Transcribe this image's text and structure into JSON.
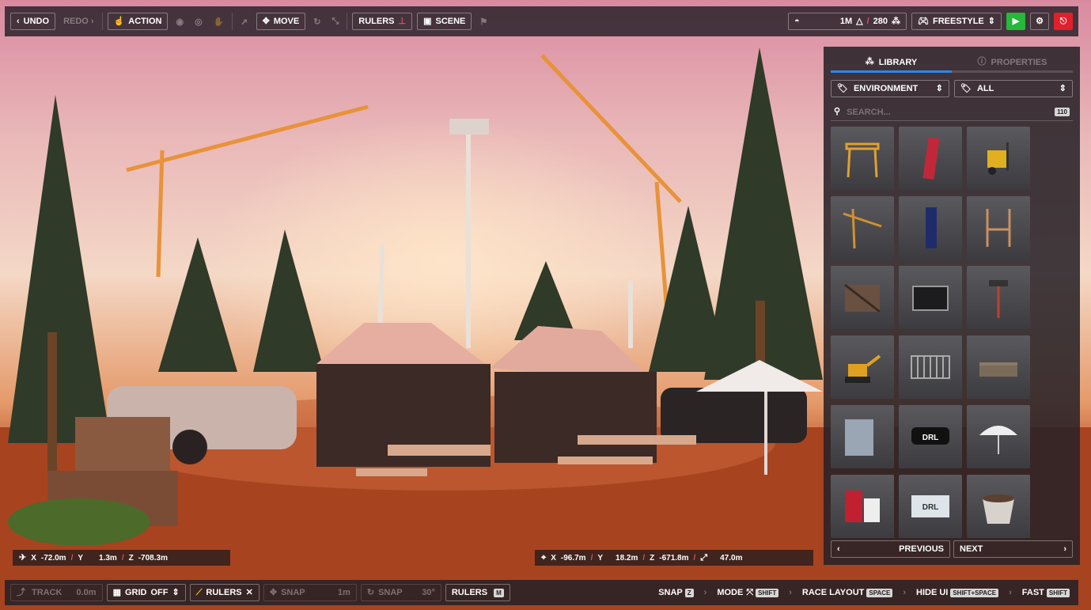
{
  "toolbar": {
    "undo": "UNDO",
    "redo": "REDO",
    "action": "ACTION",
    "move": "MOVE",
    "rulers": "RULERS",
    "scene": "SCENE",
    "polycount": "1M",
    "objectcount": "280",
    "mode": "FREESTYLE"
  },
  "panel": {
    "tab_library": "LIBRARY",
    "tab_properties": "PROPERTIES",
    "category": "ENVIRONMENT",
    "filter": "ALL",
    "search_placeholder": "SEARCH...",
    "item_count": "110",
    "previous": "PREVIOUS",
    "next": "NEXT",
    "items": [
      {
        "icon": "crane-gantry"
      },
      {
        "icon": "banner-flag-red"
      },
      {
        "icon": "forklift"
      },
      {
        "icon": "tower-crane"
      },
      {
        "icon": "banner-flag-blue"
      },
      {
        "icon": "goal-post"
      },
      {
        "icon": "wooden-crate"
      },
      {
        "icon": "flight-case"
      },
      {
        "icon": "light-tower"
      },
      {
        "icon": "excavator"
      },
      {
        "icon": "metal-barrier"
      },
      {
        "icon": "wooden-pallet"
      },
      {
        "icon": "banner-wall"
      },
      {
        "icon": "drl-sign"
      },
      {
        "icon": "umbrella"
      },
      {
        "icon": "drl-booth"
      },
      {
        "icon": "drl-fence-banner"
      },
      {
        "icon": "planter-pot"
      }
    ]
  },
  "camera_coords": {
    "x_label": "X",
    "x": "-72.0m",
    "y_label": "Y",
    "y": "1.3m",
    "z_label": "Z",
    "z": "-708.3m"
  },
  "target_coords": {
    "x_label": "X",
    "x": "-96.7m",
    "y_label": "Y",
    "y": "18.2m",
    "z_label": "Z",
    "z": "-671.8m",
    "distance": "47.0m"
  },
  "bottombar": {
    "track": "TRACK",
    "track_value": "0.0m",
    "grid": "GRID",
    "grid_value": "OFF",
    "rulers": "RULERS",
    "snap1": "SNAP",
    "snap1_value": "1m",
    "snap2": "SNAP",
    "snap2_value": "30°",
    "rulers_toggle": "RULERS",
    "rulers_key": "M",
    "snap_hint": "SNAP",
    "snap_key": "Z",
    "mode_hint": "MODE",
    "mode_key": "SHIFT",
    "race_layout": "RACE LAYOUT",
    "race_key": "SPACE",
    "hide_ui": "HIDE UI",
    "hide_key": "SHIFT+SPACE",
    "fast": "FAST",
    "fast_key": "SHIFT"
  },
  "colors": {
    "accent_blue": "#2f86e6",
    "play_green": "#25b83a",
    "exit_red": "#e0202a",
    "coord_slash": "#e05060"
  }
}
